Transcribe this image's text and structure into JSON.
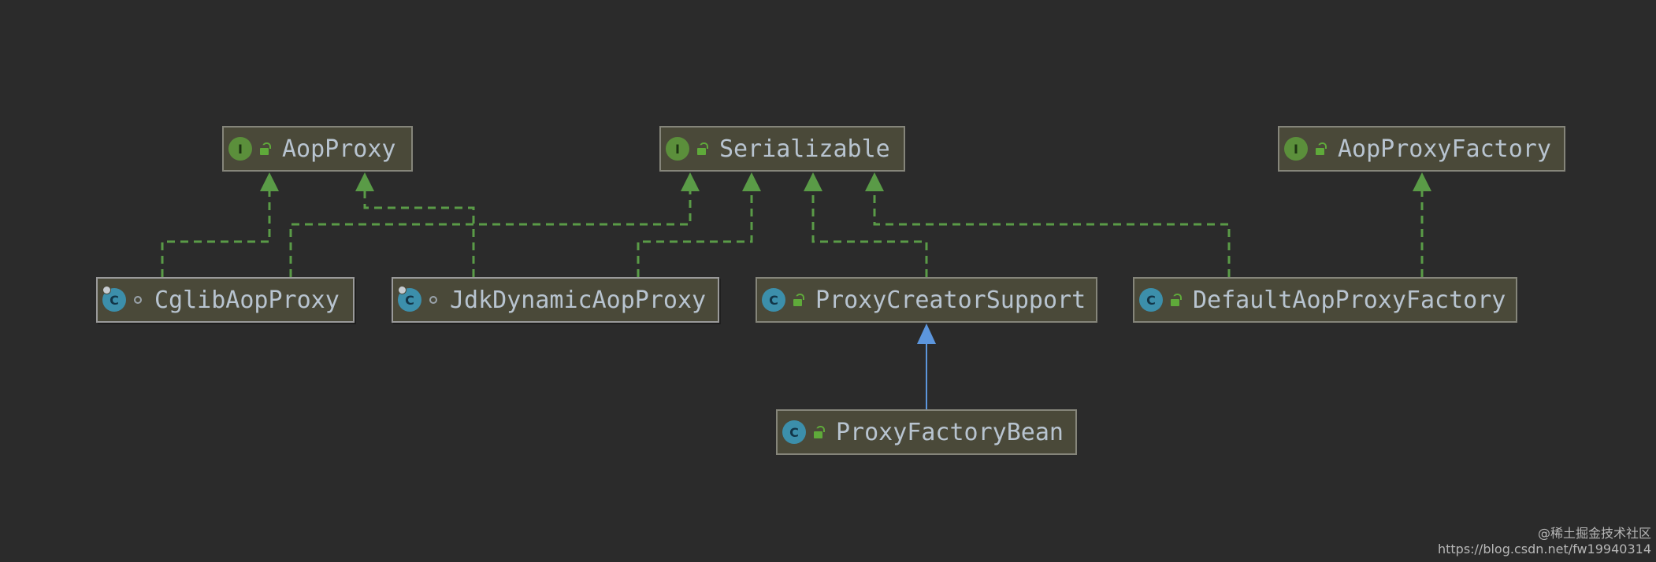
{
  "diagram": {
    "nodes": {
      "aop_proxy": {
        "label": "AopProxy",
        "kind": "interface",
        "kind_letter": "I",
        "visibility": "public"
      },
      "serializable": {
        "label": "Serializable",
        "kind": "interface",
        "kind_letter": "I",
        "visibility": "public"
      },
      "aop_proxy_factory": {
        "label": "AopProxyFactory",
        "kind": "interface",
        "kind_letter": "I",
        "visibility": "public"
      },
      "cglib_aop_proxy": {
        "label": "CglibAopProxy",
        "kind": "class",
        "kind_letter": "C",
        "visibility": "package-private",
        "abstract_marker": true
      },
      "jdk_dynamic_aop_proxy": {
        "label": "JdkDynamicAopProxy",
        "kind": "class",
        "kind_letter": "C",
        "visibility": "package-private",
        "abstract_marker": true
      },
      "proxy_creator_support": {
        "label": "ProxyCreatorSupport",
        "kind": "class",
        "kind_letter": "C",
        "visibility": "public"
      },
      "default_aop_proxy_factory": {
        "label": "DefaultAopProxyFactory",
        "kind": "class",
        "kind_letter": "C",
        "visibility": "public"
      },
      "proxy_factory_bean": {
        "label": "ProxyFactoryBean",
        "kind": "class",
        "kind_letter": "C",
        "visibility": "public"
      }
    },
    "edges": [
      {
        "from": "cglib_aop_proxy",
        "to": "aop_proxy",
        "type": "implements"
      },
      {
        "from": "cglib_aop_proxy",
        "to": "serializable",
        "type": "implements"
      },
      {
        "from": "jdk_dynamic_aop_proxy",
        "to": "aop_proxy",
        "type": "implements"
      },
      {
        "from": "jdk_dynamic_aop_proxy",
        "to": "serializable",
        "type": "implements"
      },
      {
        "from": "proxy_creator_support",
        "to": "serializable",
        "type": "implements"
      },
      {
        "from": "default_aop_proxy_factory",
        "to": "serializable",
        "type": "implements"
      },
      {
        "from": "default_aop_proxy_factory",
        "to": "aop_proxy_factory",
        "type": "implements"
      },
      {
        "from": "proxy_factory_bean",
        "to": "proxy_creator_support",
        "type": "extends"
      }
    ],
    "colors": {
      "background": "#2b2b2b",
      "implements_line": "#5a9b47",
      "extends_line": "#5c96dd",
      "node_fill": "#4a4939",
      "node_text": "#b8c4d0"
    }
  },
  "watermark": {
    "line1": "@稀土掘金技术社区",
    "line2": "https://blog.csdn.net/fw19940314"
  }
}
